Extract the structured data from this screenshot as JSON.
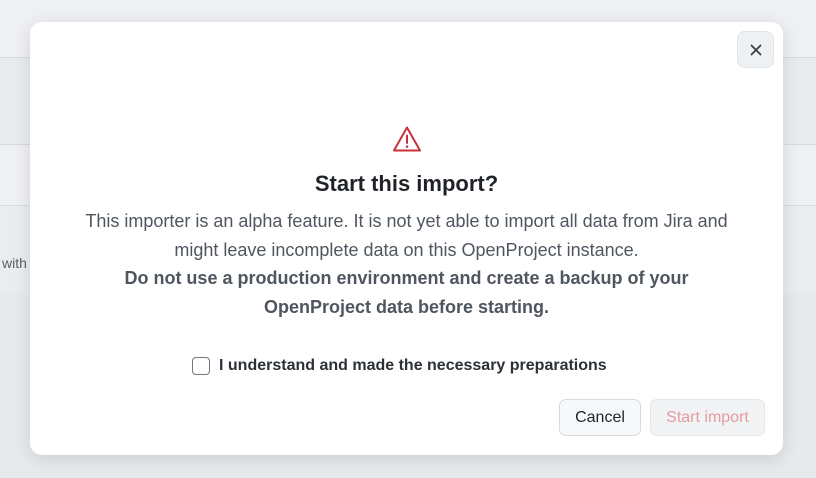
{
  "background": {
    "partial_text": "with"
  },
  "dialog": {
    "close_icon": "close-icon",
    "warning_icon": "alert-triangle-icon",
    "title": "Start this import?",
    "description_line1": "This importer is an alpha feature. It is not yet able to import all data from Jira and might leave incomplete data on this OpenProject instance.",
    "description_warning": "Do not use a production environment and create a backup of your OpenProject data before starting.",
    "confirm_label": "I understand and made the necessary preparations",
    "confirm_checked": false,
    "cancel_label": "Cancel",
    "start_label": "Start import",
    "start_disabled": true
  },
  "colors": {
    "warning": "#c8323a",
    "start_disabled_text": "#e49aa0"
  }
}
